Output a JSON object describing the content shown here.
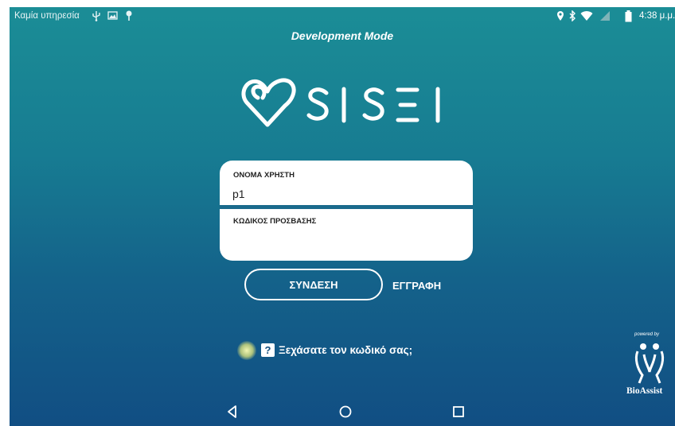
{
  "status_bar": {
    "carrier": "Καμία υπηρεσία",
    "left_icons": [
      "usb-icon",
      "image-icon",
      "pin-icon"
    ],
    "right_icons": [
      "location-icon",
      "bluetooth-icon",
      "wifi-icon",
      "signal-icon",
      "battery-icon"
    ],
    "time": "4:38 μ.μ."
  },
  "header": {
    "mode": "Development Mode"
  },
  "logo": {
    "brand": "SISEI"
  },
  "login_form": {
    "username_label": "ΟΝΟΜΑ ΧΡΗΣΤΗ",
    "username_value": "p1",
    "password_label": "ΚΩΔΙΚΟΣ ΠΡΟΣΒΑΣΗΣ",
    "password_value": ""
  },
  "actions": {
    "login_label": "ΣΥΝΔΕΣΗ",
    "register_label": "ΕΓΓΡΑΦΗ",
    "forgot_password_label": "Ξεχάσατε τον κωδικό σας;",
    "help_icon_glyph": "?"
  },
  "powered_by": {
    "caption": "powered by",
    "brand": "BioAssist"
  },
  "nav_bar": {
    "buttons": [
      "back-icon",
      "home-icon",
      "recents-icon"
    ]
  },
  "colors": {
    "background_top": "#1b8d96",
    "background_bottom": "#114e83",
    "divider": "#1a6a8c"
  }
}
